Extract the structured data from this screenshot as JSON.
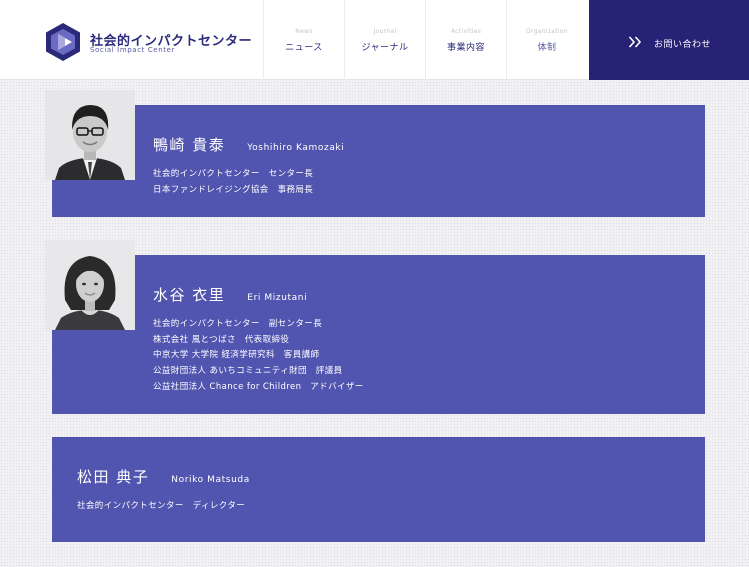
{
  "site": {
    "name_jp": "社会的インパクトセンター",
    "name_en": "Social Impact Center"
  },
  "nav": [
    {
      "en": "News",
      "jp": "ニュース"
    },
    {
      "en": "Journal",
      "jp": "ジャーナル"
    },
    {
      "en": "Activities",
      "jp": "事業内容"
    },
    {
      "en": "Organization",
      "jp": "体制"
    }
  ],
  "contact": {
    "label": "お問い合わせ",
    "icon": "double-chevron-right-icon"
  },
  "colors": {
    "brand": "#262275",
    "card": "#5255b0",
    "text_on_card": "#ffffff"
  },
  "members": [
    {
      "name_jp": "鴨崎 貴泰",
      "name_en": "Yoshihiro Kamozaki",
      "has_photo": true,
      "roles": [
        "社会的インパクトセンター　センター長",
        "日本ファンドレイジング協会　事務局長"
      ]
    },
    {
      "name_jp": "水谷 衣里",
      "name_en": "Eri Mizutani",
      "has_photo": true,
      "roles": [
        "社会的インパクトセンター　副センター長",
        "株式会社 風とつばさ　代表取締役",
        "中京大学 大学院 経済学研究科　客員講師",
        "公益財団法人 あいちコミュニティ財団　評議員",
        "公益社団法人 Chance for Children　アドバイザー"
      ]
    },
    {
      "name_jp": "松田 典子",
      "name_en": "Noriko Matsuda",
      "has_photo": false,
      "roles": [
        "社会的インパクトセンター　ディレクター"
      ]
    }
  ]
}
